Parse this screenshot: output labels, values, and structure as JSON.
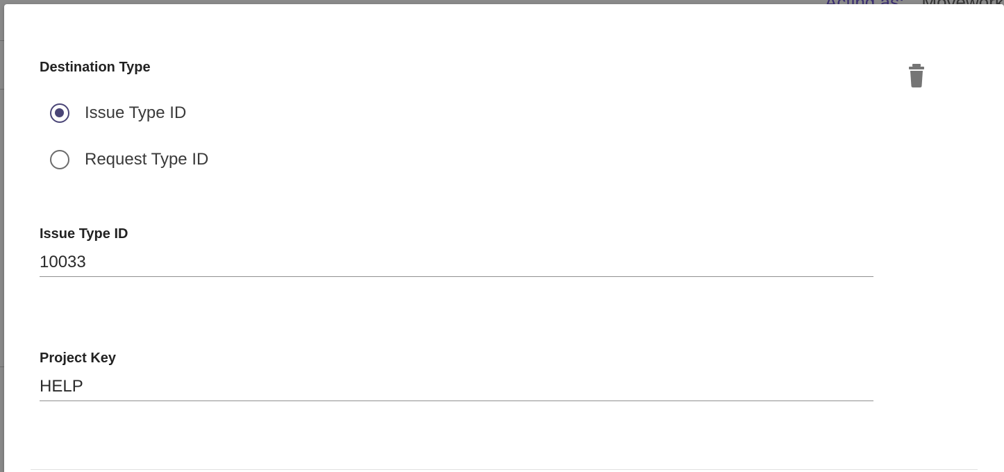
{
  "background": {
    "acting_as_label": "Acting as:",
    "acting_as_value": "Moveworks"
  },
  "form": {
    "destination_type": {
      "label": "Destination Type",
      "options": [
        {
          "label": "Issue Type ID",
          "selected": true
        },
        {
          "label": "Request Type ID",
          "selected": false
        }
      ]
    },
    "issue_type_id": {
      "label": "Issue Type ID",
      "value": "10033"
    },
    "project_key": {
      "label": "Project Key",
      "value": "HELP"
    },
    "delete_icon": "trash-icon"
  },
  "colors": {
    "accent": "#4a4577",
    "icon": "#757575"
  }
}
